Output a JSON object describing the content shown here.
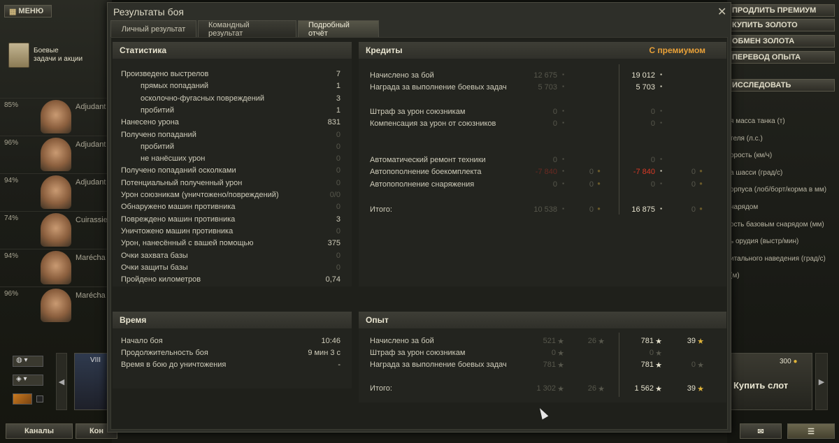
{
  "menu": {
    "label": "МЕНЮ"
  },
  "quest": {
    "line1": "Боевые",
    "line2": "задачи и акции"
  },
  "crew": [
    {
      "pct": "85%",
      "name": "Adjudant"
    },
    {
      "pct": "96%",
      "name": "Adjudant"
    },
    {
      "pct": "94%",
      "name": "Adjudant"
    },
    {
      "pct": "74%",
      "name": "Cuirassie"
    },
    {
      "pct": "94%",
      "name": "Marécha"
    },
    {
      "pct": "96%",
      "name": "Marécha"
    }
  ],
  "right_buttons": [
    "ПРОДЛИТЬ ПРЕМИУМ",
    "КУПИТЬ ЗОЛОТО",
    "ОБМЕН ЗОЛОТА",
    "ПЕРЕВОД ОПЫТА",
    "ИССЛЕДОВАТЬ"
  ],
  "right_params": [
    "я масса танка (т)",
    "теля (л.с.)",
    "орость (км/ч)",
    "а шасси (град/с)",
    "орпуса (лоб/борт/корма в мм)",
    "нарядом",
    "ость базовым снарядом (мм)",
    "ь орудия (выстр/мин)",
    "итального наведения (град/с)",
    "(м)"
  ],
  "slot": {
    "price": "300",
    "label": "Купить слот"
  },
  "bottom": {
    "channels": "Каналы",
    "contacts": "Кон",
    "tank_tier": "VIII"
  },
  "dialog": {
    "title": "Результаты боя",
    "tabs": [
      "Личный результат",
      "Командный результат",
      "Подробный отчёт"
    ],
    "stats": {
      "header": "Статистика",
      "rows": [
        {
          "label": "Произведено выстрелов",
          "value": "7",
          "indent": false,
          "dim": false
        },
        {
          "label": "прямых попаданий",
          "value": "1",
          "indent": true,
          "dim": false
        },
        {
          "label": "осколочно-фугасных повреждений",
          "value": "3",
          "indent": true,
          "dim": false
        },
        {
          "label": "пробитий",
          "value": "1",
          "indent": true,
          "dim": false
        },
        {
          "label": "Нанесено урона",
          "value": "831",
          "indent": false,
          "dim": false
        },
        {
          "label": "Получено попаданий",
          "value": "0",
          "indent": false,
          "dim": true
        },
        {
          "label": "пробитий",
          "value": "0",
          "indent": true,
          "dim": true
        },
        {
          "label": "не нанёсших урон",
          "value": "0",
          "indent": true,
          "dim": true
        },
        {
          "label": "Получено попаданий осколками",
          "value": "0",
          "indent": false,
          "dim": true
        },
        {
          "label": "Потенциальный полученный урон",
          "value": "0",
          "indent": false,
          "dim": true
        },
        {
          "label": "Урон союзникам (уничтожено/повреждений)",
          "value": "0/0",
          "indent": false,
          "dim": true
        },
        {
          "label": "Обнаружено машин противника",
          "value": "0",
          "indent": false,
          "dim": true
        },
        {
          "label": "Повреждено машин противника",
          "value": "3",
          "indent": false,
          "dim": false
        },
        {
          "label": "Уничтожено машин противника",
          "value": "0",
          "indent": false,
          "dim": true
        },
        {
          "label": "Урон, нанесённый с вашей помощью",
          "value": "375",
          "indent": false,
          "dim": false
        },
        {
          "label": "Очки захвата базы",
          "value": "0",
          "indent": false,
          "dim": true
        },
        {
          "label": "Очки защиты базы",
          "value": "0",
          "indent": false,
          "dim": true
        },
        {
          "label": "Пройдено километров",
          "value": "0,74",
          "indent": false,
          "dim": false
        }
      ]
    },
    "credits": {
      "header": "Кредиты",
      "premium": "С премиумом",
      "rows": [
        {
          "label": "Начислено за бой",
          "c1": "12 675",
          "g1": "",
          "c2": "19 012",
          "g2": ""
        },
        {
          "label": "Награда за выполнение боевых задач",
          "c1": "5 703",
          "g1": "",
          "c2": "5 703",
          "g2": ""
        },
        {
          "label": "Штраф за урон союзникам",
          "c1": "0",
          "g1": "",
          "c2": "0",
          "g2": ""
        },
        {
          "label": "Компенсация за урон от союзников",
          "c1": "0",
          "g1": "",
          "c2": "0",
          "g2": ""
        },
        {
          "label": "Автоматический ремонт техники",
          "c1": "0",
          "g1": "",
          "c2": "0",
          "g2": ""
        },
        {
          "label": "Автопополнение боекомплекта",
          "c1": "-7 840",
          "g1": "0",
          "c2": "-7 840",
          "g2": "0"
        },
        {
          "label": "Автопополнение снаряжения",
          "c1": "0",
          "g1": "0",
          "c2": "0",
          "g2": "0"
        },
        {
          "label": "Итого:",
          "c1": "10 538",
          "g1": "0",
          "c2": "16 875",
          "g2": "0"
        }
      ]
    },
    "time": {
      "header": "Время",
      "rows": [
        {
          "label": "Начало боя",
          "value": "10:46"
        },
        {
          "label": "Продолжительность боя",
          "value": "9 мин 3 с"
        },
        {
          "label": "Время в бою до уничтожения",
          "value": "-"
        }
      ]
    },
    "exp": {
      "header": "Опыт",
      "rows": [
        {
          "label": "Начислено за бой",
          "x1": "521",
          "f1": "26",
          "x2": "781",
          "f2": "39"
        },
        {
          "label": "Штраф за урон союзникам",
          "x1": "0",
          "f1": "",
          "x2": "0",
          "f2": ""
        },
        {
          "label": "Награда за выполнение боевых задач",
          "x1": "781",
          "f1": "",
          "x2": "781",
          "f2": "0"
        },
        {
          "label": "Итого:",
          "x1": "1 302",
          "f1": "26",
          "x2": "1 562",
          "f2": "39"
        }
      ]
    }
  },
  "colors": {
    "premium": "#e8a038",
    "negative": "#d83a26",
    "gold": "#e0b43a"
  },
  "icons": [
    "credits-icon",
    "gold-icon",
    "star-icon",
    "close-icon",
    "chat-icon",
    "list-icon",
    "globe-icon"
  ]
}
